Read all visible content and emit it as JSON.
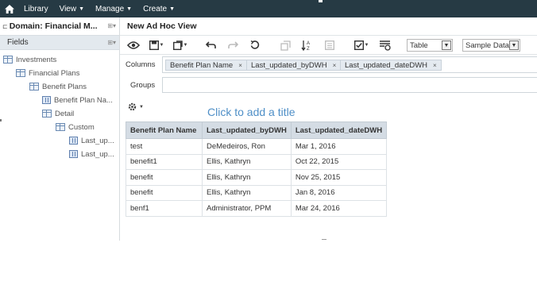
{
  "topnav": {
    "home_icon": "home-icon",
    "menus": [
      {
        "label": "Library",
        "has_caret": false
      },
      {
        "label": "View",
        "has_caret": true
      },
      {
        "label": "Manage",
        "has_caret": true
      },
      {
        "label": "Create",
        "has_caret": true
      }
    ]
  },
  "leftpanel": {
    "domain_title": "Domain: Financial M...",
    "fields_label": "Fields",
    "tree": [
      {
        "label": "Investments",
        "icon": "table-icon"
      },
      {
        "label": "Financial Plans",
        "icon": "table-icon"
      },
      {
        "label": "Benefit Plans",
        "icon": "table-icon"
      },
      {
        "label": "Benefit Plan Na...",
        "icon": "field-icon"
      },
      {
        "label": "Detail",
        "icon": "table-icon"
      },
      {
        "label": "Custom",
        "icon": "table-icon"
      },
      {
        "label": "Last_up...",
        "icon": "field-icon"
      },
      {
        "label": "Last_up...",
        "icon": "field-icon"
      }
    ]
  },
  "main": {
    "view_title": "New Ad Hoc View",
    "toolbar": {
      "icons": [
        "eye-icon",
        "save-icon",
        "export-icon",
        "undo-icon",
        "redo-icon",
        "reset-icon",
        "pivot-icon",
        "sort-icon",
        "query-icon",
        "input-controls-icon",
        "filter-icon"
      ],
      "view_type": "Table",
      "data_mode": "Sample Data"
    },
    "columns_label": "Columns",
    "columns": [
      "Benefit Plan Name",
      "Last_updated_byDWH",
      "Last_updated_dateDWH"
    ],
    "groups_label": "Groups",
    "title_placeholder": "Click to add a title",
    "table": {
      "headers": [
        "Benefit Plan Name",
        "Last_updated_byDWH",
        "Last_updated_dateDWH"
      ],
      "rows": [
        [
          "test",
          "DeMedeiros, Ron",
          "Mar 1, 2016"
        ],
        [
          "benefit1",
          "Ellis, Kathryn",
          "Oct 22, 2015"
        ],
        [
          "benefit",
          "Ellis, Kathryn",
          "Nov 25, 2015"
        ],
        [
          "benefit",
          "Ellis, Kathryn",
          "Jan 8, 2016"
        ],
        [
          "benf1",
          "Administrator, PPM",
          "Mar 24, 2016"
        ]
      ]
    }
  }
}
